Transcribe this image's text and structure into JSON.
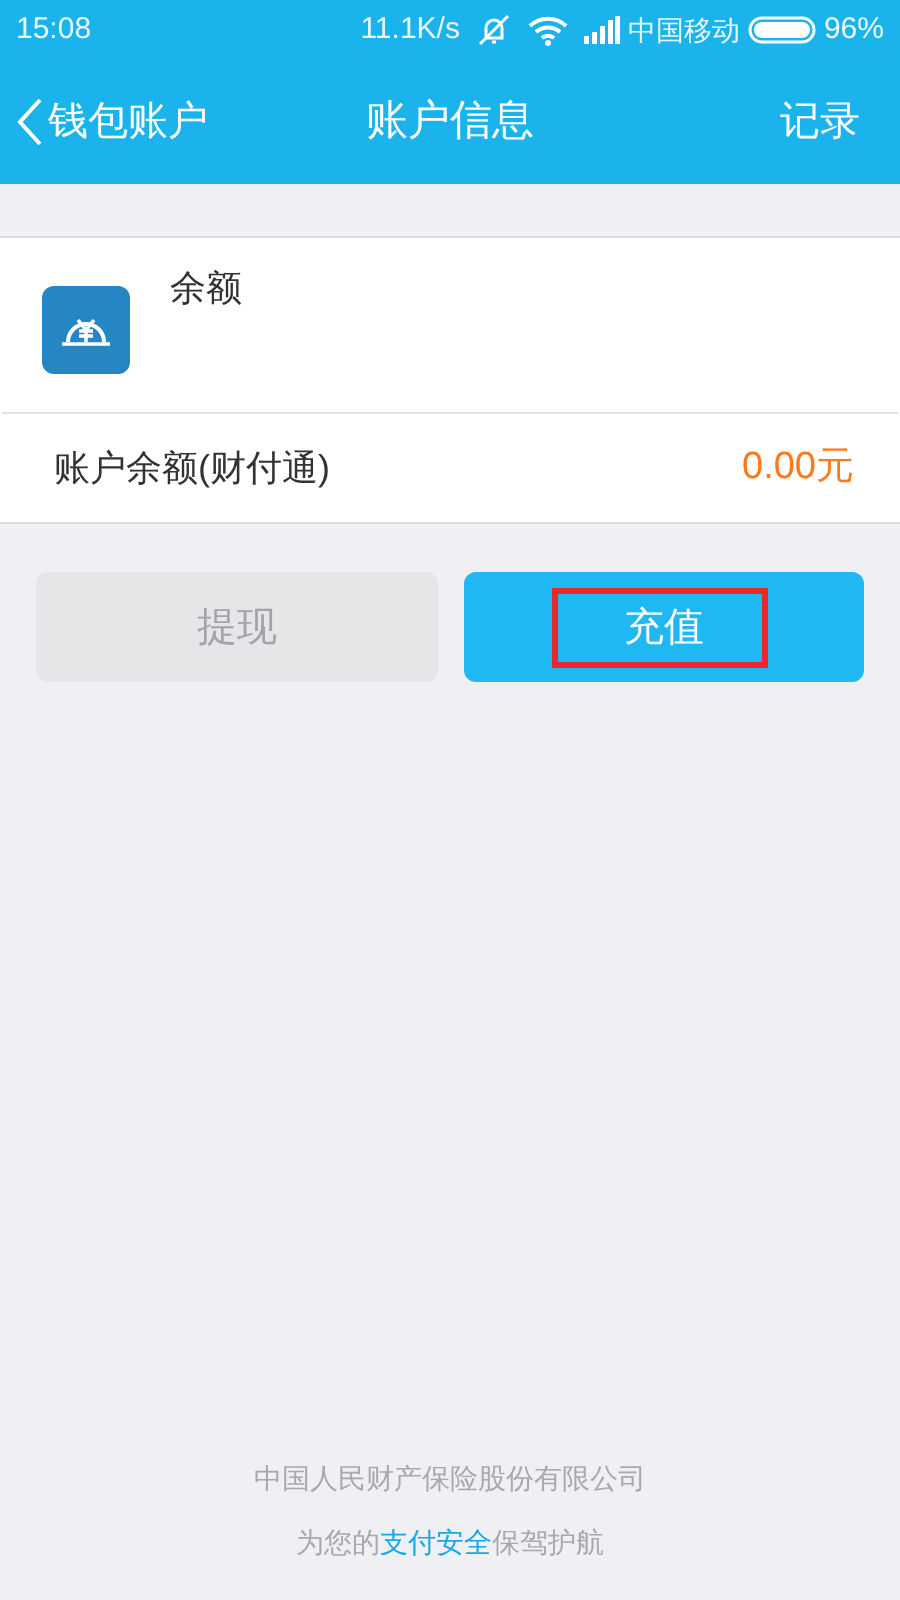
{
  "status_bar": {
    "time": "15:08",
    "speed": "11.1K/s",
    "carrier": "中国移动",
    "battery": "96%"
  },
  "nav": {
    "back": "钱包账户",
    "title": "账户信息",
    "action": "记录"
  },
  "balance_card": {
    "title": "余额",
    "label": "账户余额(财付通)",
    "amount": "0.00元"
  },
  "buttons": [
    {
      "label": "提现",
      "disabled": true,
      "highlighted": false
    },
    {
      "label": "充值",
      "disabled": false,
      "highlighted": true
    }
  ],
  "footer": {
    "company": "中国人民财产保险股份有限公司",
    "slogan_before": "为您的",
    "slogan_highlight": "支付安全",
    "slogan_after": "保驾护航"
  }
}
